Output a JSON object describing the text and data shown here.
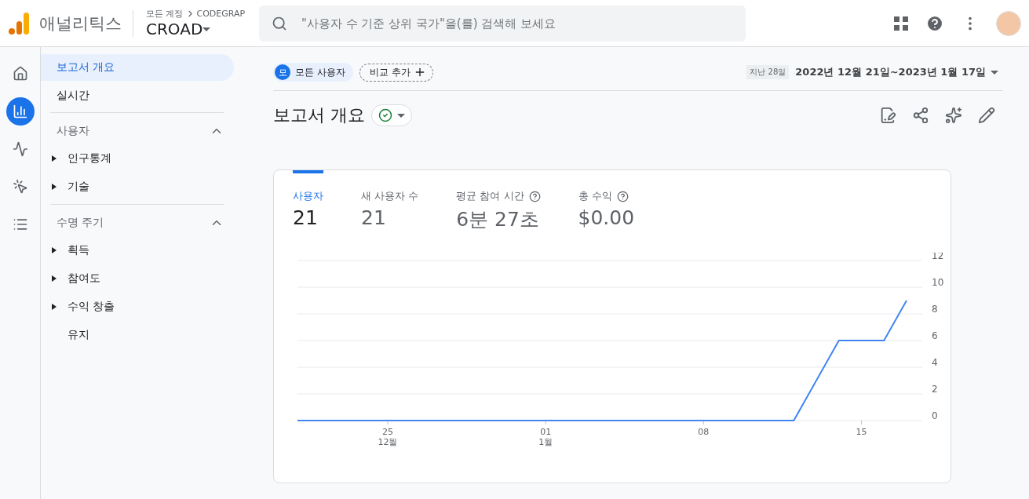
{
  "header": {
    "product": "애널리틱스",
    "breadcrumb": "모든 계정",
    "account": "CODEGRAP",
    "property": "CROAD",
    "search": {
      "placeholder": "\"사용자 수 기준 상위 국가\"을(를) 검색해 보세요"
    }
  },
  "rail": [
    {
      "selected": false
    },
    {
      "selected": true
    },
    {
      "selected": false
    },
    {
      "selected": false
    },
    {
      "selected": false
    }
  ],
  "nav": [
    {
      "kind": "link",
      "label": "보고서 개요",
      "selected": true
    },
    {
      "kind": "link",
      "label": "실시간",
      "selected": false
    },
    {
      "kind": "section",
      "label": "사용자",
      "expanded": true,
      "children": [
        {
          "kind": "folder",
          "label": "인구통계",
          "selected": false
        },
        {
          "kind": "folder",
          "label": "기술",
          "selected": false
        }
      ]
    },
    {
      "kind": "section",
      "label": "수명 주기",
      "expanded": true,
      "children": [
        {
          "kind": "folder",
          "label": "획득",
          "selected": false
        },
        {
          "kind": "folder",
          "label": "참여도",
          "selected": false
        },
        {
          "kind": "folder",
          "label": "수익 창출",
          "selected": false
        },
        {
          "kind": "page",
          "label": "유지",
          "selected": false
        }
      ]
    }
  ],
  "filters": {
    "segment_badge": "모",
    "segment": "모든 사용자",
    "add_comparison": "비교 추가"
  },
  "date_range": {
    "period": "지난 28일",
    "range": "2022년 12월 21일~2023년 1월 17일"
  },
  "report_title": "보고서 개요",
  "metrics": [
    {
      "label": "사용자",
      "value": "21",
      "selected": true,
      "help": false
    },
    {
      "label": "새 사용자 수",
      "value": "21",
      "selected": false,
      "help": false
    },
    {
      "label": "평균 참여 시간",
      "value": "6분 27초",
      "selected": false,
      "help": true
    },
    {
      "label": "총 수익",
      "value": "$0.00",
      "selected": false,
      "help": true
    }
  ],
  "chart_data": {
    "type": "line",
    "categories": [
      null,
      null,
      null,
      null,
      "25\n12월",
      null,
      null,
      null,
      null,
      null,
      null,
      "01\n1월",
      null,
      null,
      null,
      null,
      null,
      null,
      "08",
      null,
      null,
      null,
      null,
      null,
      null,
      "15",
      null,
      null
    ],
    "series": [
      {
        "color": "#4285f4",
        "values": [
          0,
          0,
          0,
          0,
          0,
          0,
          0,
          0,
          0,
          0,
          0,
          0,
          0,
          0,
          0,
          0,
          0,
          0,
          0,
          0,
          0,
          0,
          0,
          3,
          6,
          6,
          6,
          9
        ]
      }
    ],
    "ylim": [
      0,
      12
    ],
    "grid": true,
    "yticks": [
      0,
      2,
      4,
      6,
      8,
      10,
      12
    ]
  }
}
